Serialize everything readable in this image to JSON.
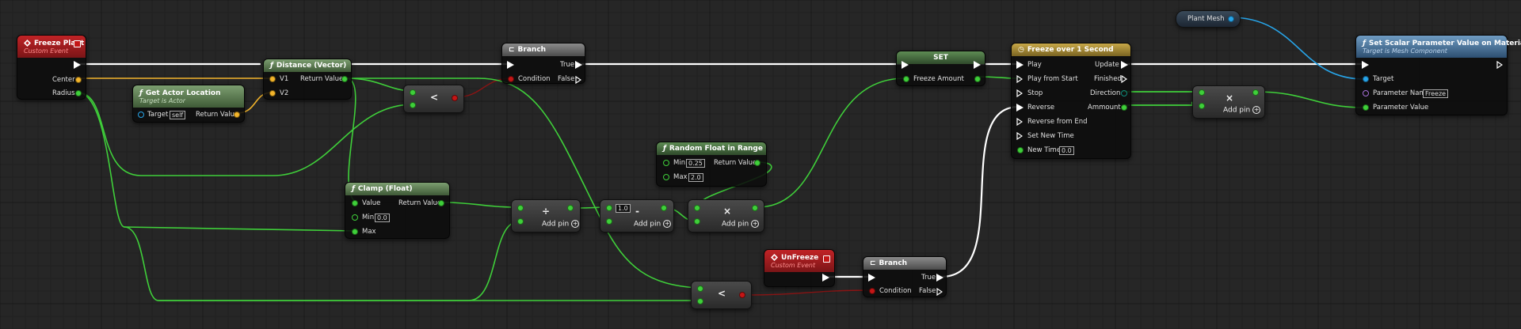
{
  "nodes": {
    "freeze_plant": {
      "title": "Freeze Plant",
      "subtitle": "Custom Event",
      "center": "Center",
      "radius": "Radius"
    },
    "get_actor_location": {
      "title": "Get Actor Location",
      "subtitle": "Target is Actor",
      "target": "Target",
      "target_value": "self",
      "return_value": "Return Value"
    },
    "distance": {
      "title": "Distance (Vector)",
      "v1": "V1",
      "v2": "V2",
      "return_value": "Return Value"
    },
    "less1": {
      "symbol": "<"
    },
    "branch1": {
      "title": "Branch",
      "condition": "Condition",
      "true": "True",
      "false": "False"
    },
    "clamp": {
      "title": "Clamp (Float)",
      "value": "Value",
      "min": "Min",
      "min_value": "0.0",
      "max": "Max",
      "return_value": "Return Value"
    },
    "divide": {
      "symbol": "÷",
      "add_pin": "Add pin"
    },
    "subtract": {
      "symbol": "-",
      "field": "1.0",
      "add_pin": "Add pin"
    },
    "random": {
      "title": "Random Float in Range",
      "min": "Min",
      "min_value": "0.25",
      "max": "Max",
      "max_value": "2.0",
      "return_value": "Return Value"
    },
    "multiply1": {
      "symbol": "×",
      "add_pin": "Add pin"
    },
    "set": {
      "title": "SET",
      "freeze_amount": "Freeze Amount"
    },
    "unfreeze": {
      "title": "UnFreeze",
      "subtitle": "Custom Event"
    },
    "less2": {
      "symbol": "<"
    },
    "branch2": {
      "title": "Branch",
      "condition": "Condition",
      "true": "True",
      "false": "False"
    },
    "timeline": {
      "title": "Freeze over 1 Second",
      "play": "Play",
      "play_from_start": "Play from Start",
      "stop": "Stop",
      "reverse": "Reverse",
      "reverse_from_end": "Reverse from End",
      "set_new_time": "Set New Time",
      "new_time": "New Time",
      "new_time_value": "0.0",
      "update": "Update",
      "finished": "Finished",
      "direction": "Direction",
      "ammount": "Ammount"
    },
    "plant_mesh": {
      "title": "Plant Mesh"
    },
    "multiply2": {
      "symbol": "×",
      "add_pin": "Add pin"
    },
    "set_scalar": {
      "title": "Set Scalar Parameter Value on Materials",
      "subtitle": "Target is Mesh Component",
      "target": "Target",
      "parameter_name": "Parameter Name",
      "parameter_name_value": "Freeze",
      "parameter_value": "Parameter Value"
    }
  },
  "colors": {
    "exec_wire": "#ffffff",
    "float_wire": "#3fcf3a",
    "vector_wire": "#f2b42b",
    "object_wire": "#27a4e8",
    "bool_wire": "#8a1414"
  }
}
